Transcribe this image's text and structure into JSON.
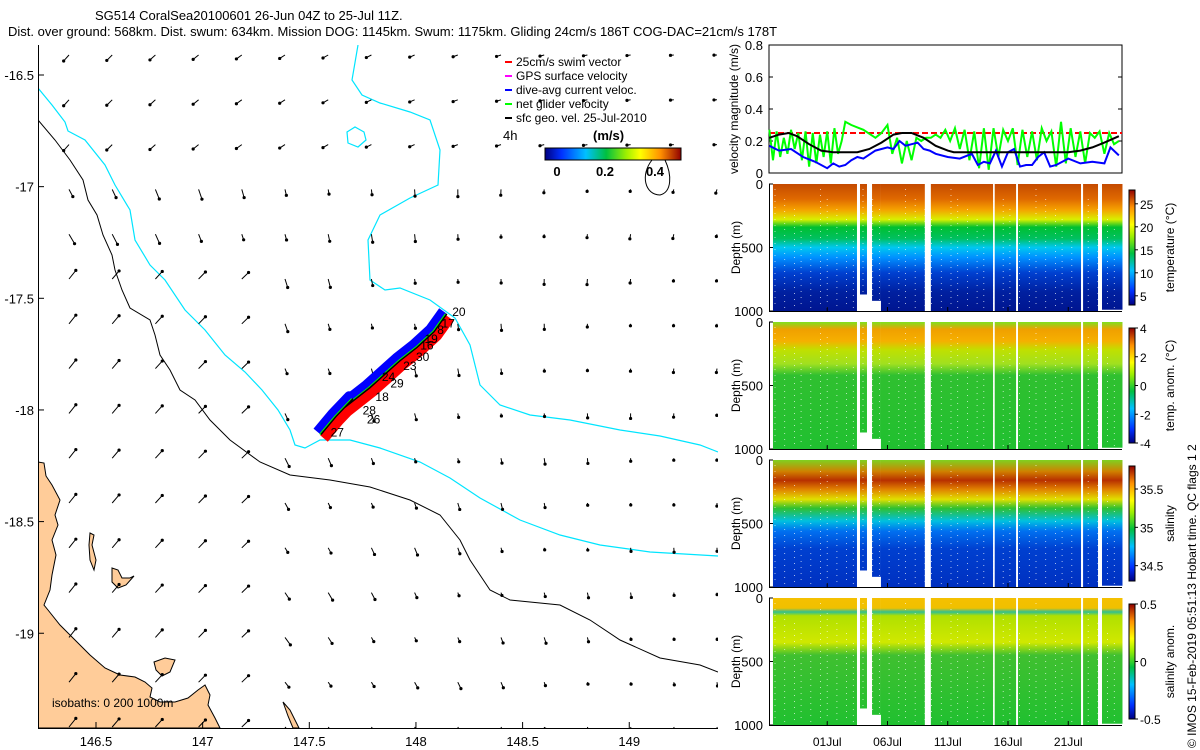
{
  "header": {
    "title": "SG514 CoralSea20100601 26-Jun 04Z to 25-Jul 11Z.",
    "subtitle": "Dist. over ground: 568km. Dist. swum: 634km. Mission DOG: 1145km. Swum: 1175km. Gliding 24cm/s 186T COG-DAC=21cm/s 178T"
  },
  "footer": {
    "credit": "© IMOS 15-Feb-2019 05:51:13 Hobart time. QC flags 1  2"
  },
  "colors": {
    "land": "#FFCC99",
    "isobath200": "#00E5FF",
    "isobath1000": "#000000",
    "swim": "#FF0000",
    "gps": "#FF00FF",
    "dac": "#0000FF",
    "net": "#00FF00",
    "sfc": "#000000"
  },
  "chart_data": [
    {
      "type": "map",
      "legend": [
        {
          "label": "25cm/s swim vector",
          "color": "#FF0000"
        },
        {
          "label": "GPS surface velocity",
          "color": "#FF00FF"
        },
        {
          "label": "dive-avg current veloc.",
          "color": "#0000FF"
        },
        {
          "label": "net glider velocity",
          "color": "#00FF00"
        },
        {
          "label": "sfc geo. vel. 25-Jul-2010",
          "color": "#000000"
        }
      ],
      "legend_placement": "top-right",
      "time_offset_label": "4h",
      "colorbar": {
        "label": "(m/s)",
        "ticks": [
          "0",
          "0.2",
          "0.4"
        ],
        "range": [
          -0.05,
          0.5
        ]
      },
      "isobaths_label": "isobaths: 0   200  1000m",
      "xlim": [
        146.22,
        149.42
      ],
      "ylim": [
        -19.42,
        -16.37
      ],
      "xticks": [
        "146.5",
        "147",
        "147.5",
        "148",
        "148.5",
        "149"
      ],
      "yticks": [
        "-16.5",
        "-17",
        "-17.5",
        "-18",
        "-18.5",
        "-19"
      ],
      "track": [
        [
          147.55,
          -18.11
        ],
        [
          147.62,
          -18.03
        ],
        [
          147.7,
          -17.95
        ],
        [
          147.66,
          -17.99
        ],
        [
          147.78,
          -17.9
        ],
        [
          147.85,
          -17.84
        ],
        [
          147.92,
          -17.78
        ],
        [
          148.0,
          -17.72
        ],
        [
          148.08,
          -17.65
        ],
        [
          148.14,
          -17.57
        ]
      ],
      "dive_labels": [
        {
          "text": "20",
          "lon": 148.17,
          "lat": -17.58
        },
        {
          "text": "17",
          "lon": 148.12,
          "lat": -17.63
        },
        {
          "text": "8",
          "lon": 148.1,
          "lat": -17.66
        },
        {
          "text": "19",
          "lon": 148.04,
          "lat": -17.7
        },
        {
          "text": "16",
          "lon": 148.02,
          "lat": -17.73
        },
        {
          "text": "30",
          "lon": 148.0,
          "lat": -17.78
        },
        {
          "text": "23",
          "lon": 147.94,
          "lat": -17.82
        },
        {
          "text": "24",
          "lon": 147.84,
          "lat": -17.87
        },
        {
          "text": "29",
          "lon": 147.88,
          "lat": -17.9
        },
        {
          "text": "18",
          "lon": 147.81,
          "lat": -17.96
        },
        {
          "text": "28",
          "lon": 147.75,
          "lat": -18.02
        },
        {
          "text": "26",
          "lon": 147.77,
          "lat": -18.06
        },
        {
          "text": "27",
          "lon": 147.6,
          "lat": -18.12
        }
      ]
    },
    {
      "type": "line",
      "ylabel": "velocity magnitude (m/s)",
      "ylim": [
        0,
        0.8
      ],
      "yticks": [
        "0",
        "0.2",
        "0.4",
        "0.6",
        "0.8"
      ],
      "xlim_days": [
        0.17,
        29.46
      ],
      "series": [
        {
          "name": "swim",
          "color": "#FF0000",
          "dashed": true,
          "x": [
            0.17,
            29.46
          ],
          "y": [
            0.25,
            0.25
          ]
        },
        {
          "name": "net glider velocity",
          "color": "#00FF00",
          "x": [
            0.2,
            0.5,
            0.8,
            1.1,
            1.4,
            1.7,
            2.0,
            2.3,
            2.6,
            2.9,
            3.2,
            3.5,
            3.8,
            4.1,
            4.4,
            4.7,
            5.0,
            5.3,
            5.6,
            5.9,
            6.2,
            6.5,
            7.0,
            8.0,
            9.0,
            9.5,
            10.0,
            10.4,
            10.8,
            11.2,
            11.6,
            12.0,
            12.4,
            12.8,
            13.2,
            13.6,
            14.0,
            14.4,
            14.8,
            15.2,
            15.6,
            16.0,
            16.4,
            16.8,
            17.2,
            17.6,
            18.0,
            18.4,
            18.8,
            19.2,
            19.6,
            20.0,
            20.4,
            20.8,
            21.2,
            21.6,
            22.0,
            22.4,
            22.8,
            23.2,
            23.6,
            24.0,
            24.4,
            24.8,
            25.2,
            25.6,
            26.0,
            26.4,
            26.8,
            27.2,
            27.6,
            28.0,
            28.4,
            28.8,
            29.2
          ],
          "y": [
            0.27,
            0.08,
            0.26,
            0.1,
            0.22,
            0.12,
            0.27,
            0.15,
            0.25,
            0.08,
            0.26,
            0.04,
            0.25,
            0.06,
            0.24,
            0.1,
            0.26,
            0.06,
            0.28,
            0.12,
            0.2,
            0.32,
            0.3,
            0.27,
            0.22,
            0.25,
            0.3,
            0.12,
            0.22,
            0.06,
            0.2,
            0.08,
            0.22,
            0.2,
            0.22,
            0.22,
            0.24,
            0.22,
            0.27,
            0.2,
            0.28,
            0.15,
            0.27,
            0.08,
            0.26,
            0.03,
            0.28,
            0.02,
            0.28,
            0.1,
            0.27,
            0.2,
            0.28,
            0.05,
            0.27,
            0.1,
            0.26,
            0.08,
            0.28,
            0.2,
            0.26,
            0.04,
            0.32,
            0.06,
            0.28,
            0.1,
            0.26,
            0.06,
            0.25,
            0.22,
            0.26,
            0.12,
            0.25,
            0.18,
            0.2
          ]
        },
        {
          "name": "dive-avg current",
          "color": "#0000FF",
          "x": [
            0.2,
            1,
            2,
            3,
            4,
            5,
            5.5,
            6,
            6.5,
            7,
            7.5,
            8,
            9,
            10,
            10.5,
            11,
            11.5,
            12,
            12.5,
            13,
            13.5,
            14,
            15,
            16,
            17,
            17.5,
            18,
            18.5,
            19,
            19.5,
            20,
            20.5,
            21,
            21.5,
            22,
            22.5,
            23,
            23.5,
            24,
            25,
            26,
            27,
            28,
            28.5,
            29.2
          ],
          "y": [
            0.17,
            0.14,
            0.15,
            0.1,
            0.07,
            0.03,
            0.06,
            0.04,
            0.05,
            0.08,
            0.1,
            0.09,
            0.14,
            0.16,
            0.15,
            0.2,
            0.17,
            0.18,
            0.19,
            0.15,
            0.14,
            0.12,
            0.1,
            0.09,
            0.12,
            0.05,
            0.07,
            0.06,
            0.14,
            0.04,
            0.13,
            0.15,
            0.04,
            0.05,
            0.05,
            0.1,
            0.13,
            0.04,
            0.05,
            0.09,
            0.06,
            0.07,
            0.06,
            0.16,
            0.11
          ]
        },
        {
          "name": "sfc geo. vel.",
          "color": "#000000",
          "x": [
            0.2,
            1,
            1.8,
            2.5,
            3.5,
            4.5,
            5.5,
            6.5,
            7.5,
            8.5,
            9.5,
            10.5,
            11.2,
            12,
            13,
            14,
            15,
            15.5,
            17,
            19,
            21,
            23,
            25,
            26,
            27,
            28,
            29.2
          ],
          "y": [
            0.22,
            0.24,
            0.25,
            0.23,
            0.18,
            0.14,
            0.13,
            0.13,
            0.13,
            0.15,
            0.19,
            0.24,
            0.25,
            0.25,
            0.22,
            0.17,
            0.14,
            0.13,
            0.13,
            0.13,
            0.13,
            0.13,
            0.13,
            0.14,
            0.16,
            0.19,
            0.23
          ]
        }
      ]
    },
    {
      "type": "heatmap",
      "xticks": [
        {
          "day": 5,
          "label": "01Jul"
        },
        {
          "day": 10,
          "label": "06Jul"
        },
        {
          "day": 15,
          "label": "11Jul"
        },
        {
          "day": 20,
          "label": "16Jul"
        },
        {
          "day": 25,
          "label": "21Jul"
        }
      ],
      "ylabel": "Depth (m)",
      "ylim": [
        1000,
        0
      ],
      "yticks": [
        "0",
        "500",
        "1000"
      ],
      "coverage_days": [
        [
          0.5,
          7.47,
          1000
        ],
        [
          7.72,
          8.3,
          870
        ],
        [
          8.72,
          9.46,
          920
        ],
        [
          9.46,
          13.1,
          1000
        ],
        [
          13.6,
          18.76,
          1000
        ],
        [
          18.9,
          20.67,
          1000
        ],
        [
          20.83,
          26.06,
          1000
        ],
        [
          26.23,
          27.47,
          1000
        ],
        [
          27.8,
          29.5,
          990
        ]
      ],
      "panels": [
        {
          "label": "temperature (°C)",
          "cticks": [
            "5",
            "10",
            "15",
            "20",
            "25"
          ],
          "crange": [
            3,
            28
          ],
          "profile": [
            [
              0,
              "#c44a00"
            ],
            [
              120,
              "#e06a00"
            ],
            [
              200,
              "#f5a000"
            ],
            [
              280,
              "#d8f000"
            ],
            [
              340,
              "#00c030"
            ],
            [
              430,
              "#00c060"
            ],
            [
              500,
              "#00c8f0"
            ],
            [
              580,
              "#0090ff"
            ],
            [
              700,
              "#0040d0"
            ],
            [
              850,
              "#0020a0"
            ],
            [
              1000,
              "#001590"
            ]
          ]
        },
        {
          "label": "temp. anom. (°C)",
          "cticks": [
            "-4",
            "-2",
            "0",
            "2",
            "4"
          ],
          "crange": [
            -4,
            4
          ],
          "profile": [
            [
              0,
              "#80e020"
            ],
            [
              60,
              "#f0a000"
            ],
            [
              150,
              "#f5b000"
            ],
            [
              220,
              "#c0e000"
            ],
            [
              330,
              "#a0e020"
            ],
            [
              420,
              "#30c030"
            ],
            [
              1000,
              "#20c030"
            ]
          ]
        },
        {
          "label": "salinity",
          "cticks": [
            "34.5",
            "35",
            "35.5"
          ],
          "crange": [
            34.3,
            35.8
          ],
          "profile": [
            [
              0,
              "#80d020"
            ],
            [
              90,
              "#d08000"
            ],
            [
              160,
              "#b83000"
            ],
            [
              230,
              "#e08000"
            ],
            [
              310,
              "#e0e000"
            ],
            [
              380,
              "#30c030"
            ],
            [
              480,
              "#00c0e0"
            ],
            [
              560,
              "#0070f0"
            ],
            [
              700,
              "#0040d0"
            ],
            [
              1000,
              "#0030c0"
            ]
          ]
        },
        {
          "label": "salinity anom.",
          "cticks": [
            "-0.5",
            "0",
            "0.5"
          ],
          "crange": [
            -0.5,
            0.5
          ],
          "profile": [
            [
              0,
              "#f5c000"
            ],
            [
              80,
              "#f0c000"
            ],
            [
              110,
              "#30c090"
            ],
            [
              140,
              "#b0e000"
            ],
            [
              350,
              "#d0e800"
            ],
            [
              450,
              "#40c030"
            ],
            [
              1000,
              "#20c030"
            ]
          ]
        }
      ]
    }
  ]
}
